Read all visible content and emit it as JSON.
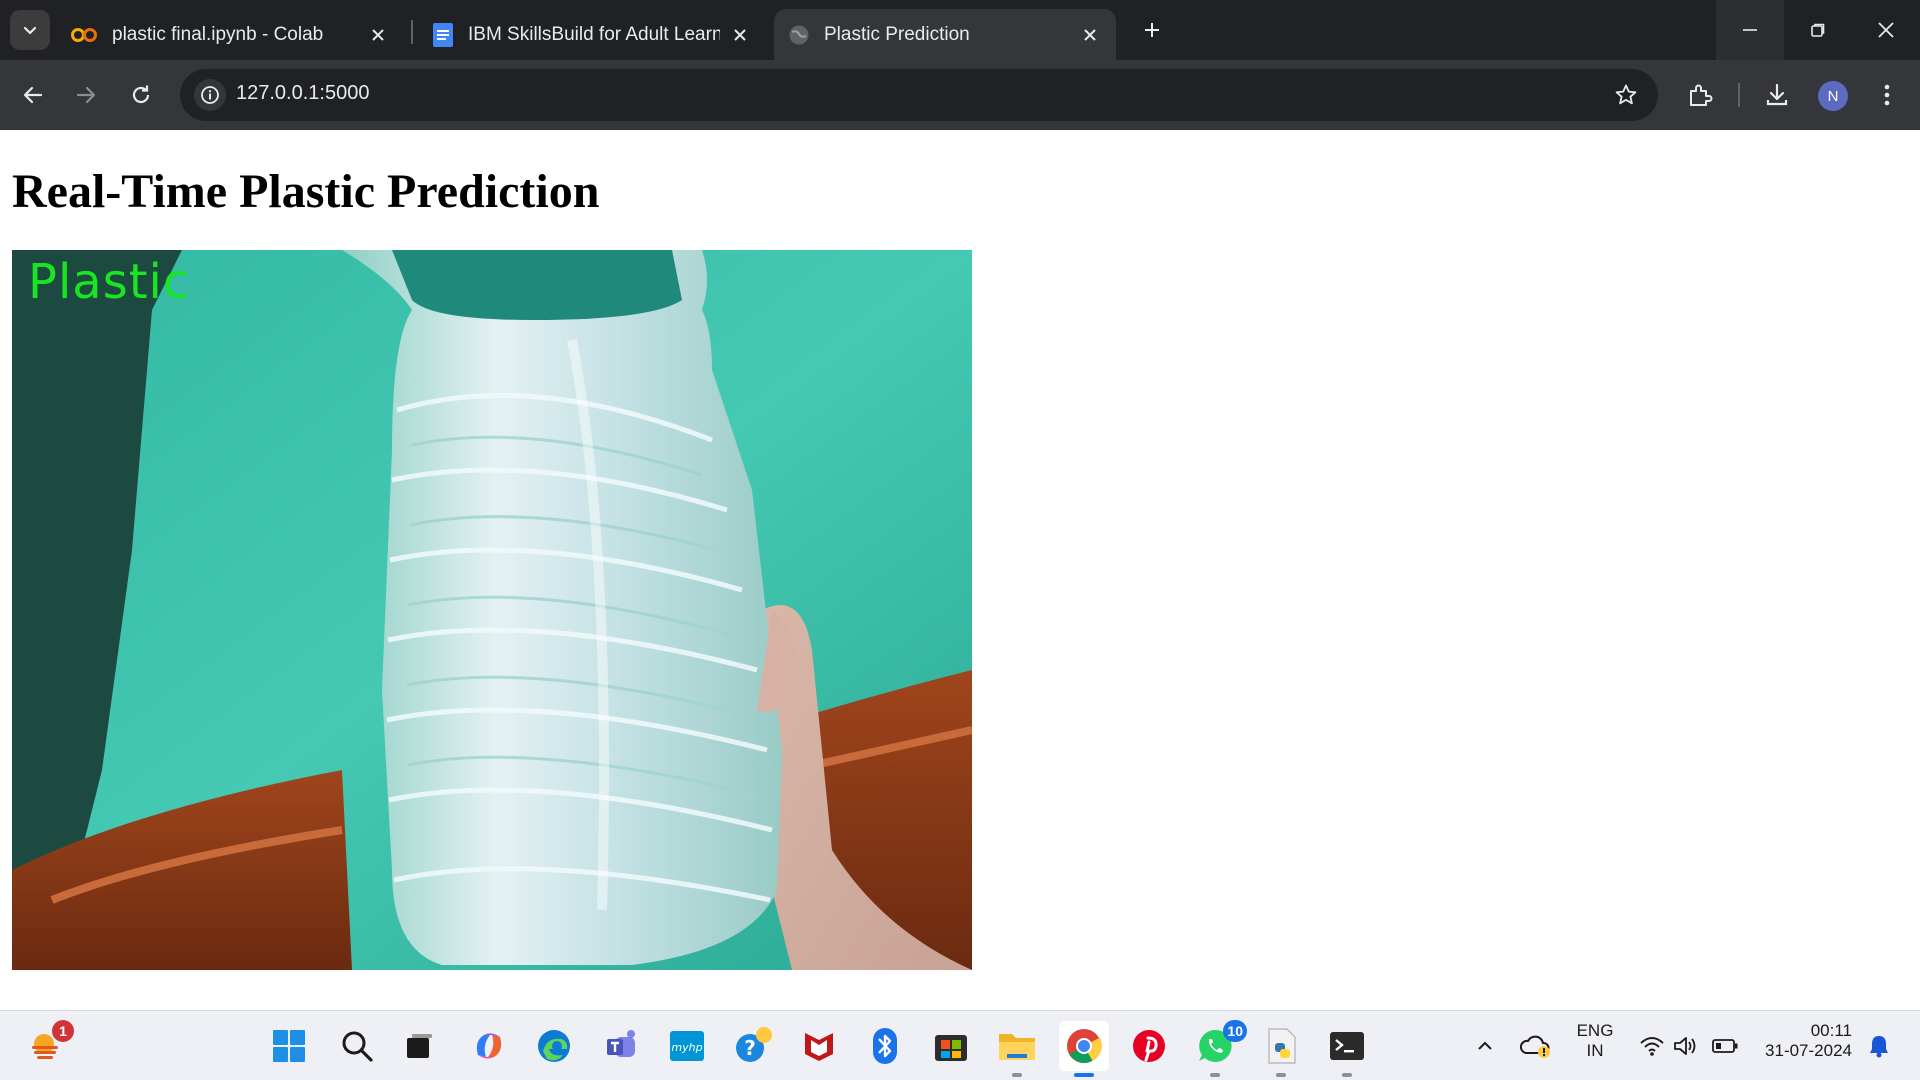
{
  "browser": {
    "tabs": [
      {
        "title": "plastic final.ipynb - Colab",
        "icon": "colab-icon",
        "active": false
      },
      {
        "title": "IBM SkillsBuild for Adult Learne",
        "icon": "docs-icon",
        "active": false
      },
      {
        "title": "Plastic Prediction",
        "icon": "globe-icon",
        "active": true
      }
    ],
    "url": "127.0.0.1:5000",
    "profile_initial": "N"
  },
  "page": {
    "title": "Real-Time Plastic Prediction",
    "prediction_label": "Plastic"
  },
  "taskbar": {
    "widgets_badge": "1",
    "apps": [
      "start",
      "search",
      "task-view",
      "copilot",
      "edge",
      "teams",
      "myhp",
      "get-help",
      "mcafee",
      "bluetooth",
      "store",
      "file-explorer",
      "chrome",
      "pinterest",
      "whatsapp",
      "python",
      "terminal"
    ],
    "whatsapp_badge": "10",
    "language": "ENG",
    "region": "IN",
    "time": "00:11",
    "date": "31-07-2024"
  }
}
